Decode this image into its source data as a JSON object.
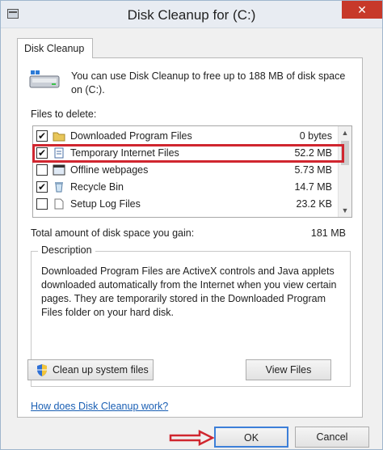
{
  "window": {
    "title": "Disk Cleanup for  (C:)",
    "close_glyph": "✕"
  },
  "tab": {
    "label": "Disk Cleanup"
  },
  "intro": {
    "text": "You can use Disk Cleanup to free up to 188 MB of disk space on  (C:)."
  },
  "files": {
    "label": "Files to delete:",
    "items": [
      {
        "name": "Downloaded Program Files",
        "size": "0 bytes",
        "checked": true,
        "icon": "folder-icon"
      },
      {
        "name": "Temporary Internet Files",
        "size": "52.2 MB",
        "checked": true,
        "icon": "document-icon"
      },
      {
        "name": "Offline webpages",
        "size": "5.73 MB",
        "checked": false,
        "icon": "webpage-icon"
      },
      {
        "name": "Recycle Bin",
        "size": "14.7 MB",
        "checked": true,
        "icon": "recycle-bin-icon"
      },
      {
        "name": "Setup Log Files",
        "size": "23.2 KB",
        "checked": false,
        "icon": "document-icon"
      }
    ]
  },
  "total": {
    "label": "Total amount of disk space you gain:",
    "value": "181 MB"
  },
  "description": {
    "legend": "Description",
    "text": "Downloaded Program Files are ActiveX controls and Java applets downloaded automatically from the Internet when you view certain pages. They are temporarily stored in the Downloaded Program Files folder on your hard disk."
  },
  "buttons": {
    "cleanup_system": "Clean up system files",
    "view_files": "View Files",
    "ok": "OK",
    "cancel": "Cancel"
  },
  "help_link": "How does Disk Cleanup work?",
  "colors": {
    "highlight": "#d0262f",
    "link": "#1a5fb4",
    "close": "#c7392a"
  }
}
